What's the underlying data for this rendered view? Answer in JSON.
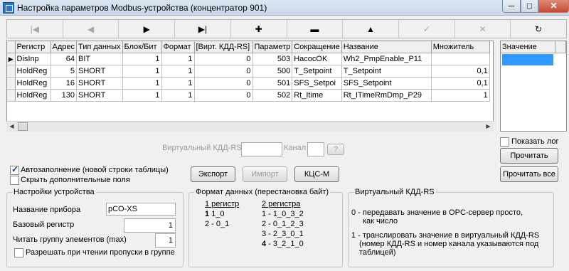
{
  "window": {
    "title": "Настройка параметров Modbus-устройства (концентратор 901)",
    "min": "─",
    "max": "□",
    "close": "✕"
  },
  "navigator": [
    {
      "glyph": "|◀",
      "enabled": false
    },
    {
      "glyph": "◀",
      "enabled": false
    },
    {
      "glyph": "▶",
      "enabled": true
    },
    {
      "glyph": "▶|",
      "enabled": true
    },
    {
      "glyph": "✚",
      "enabled": true
    },
    {
      "glyph": "▬",
      "enabled": true
    },
    {
      "glyph": "▲",
      "enabled": true
    },
    {
      "glyph": "✓",
      "enabled": false
    },
    {
      "glyph": "✕",
      "enabled": false
    },
    {
      "glyph": "↻",
      "enabled": true
    }
  ],
  "grid": {
    "columns": [
      "Регистр",
      "Адрес",
      "Тип данных",
      "Блок/Бит",
      "Формат",
      "[Вирт. КДД-RS]",
      "Параметр",
      "Сокращение",
      "Название",
      "Множитель"
    ],
    "rows": [
      [
        "DisInp",
        "64",
        "BIT",
        "1",
        "1",
        "0",
        "503",
        "HacocOK",
        "Wh2_PmpEnable_P11",
        ""
      ],
      [
        "HoldReg",
        "5",
        "SHORT",
        "1",
        "1",
        "0",
        "500",
        "T_Setpoint",
        "T_Setpoint",
        "0,1"
      ],
      [
        "HoldReg",
        "16",
        "SHORT",
        "1",
        "1",
        "0",
        "501",
        "SFS_Setpoi",
        "SFS_Setpoint",
        "0,1"
      ],
      [
        "HoldReg",
        "130",
        "SHORT",
        "1",
        "1",
        "0",
        "502",
        "Rt_Itime",
        "Rt_ITimeRmDmp_P29",
        "1"
      ]
    ],
    "current_row_marker": "▶"
  },
  "value_grid": {
    "column": "Значение"
  },
  "virtual": {
    "label": "Виртуальный КДД-RS",
    "channel_label": "Канал",
    "help": "?"
  },
  "show_log": {
    "label": "Показать лог",
    "checked": false
  },
  "buttons": {
    "read_one": "Прочитать один",
    "read_all": "Прочитать все",
    "export": "Экспорт",
    "import": "Импорт",
    "kcs": "КЦС-М"
  },
  "autofill": {
    "label": "Автозаполнение (новой строки таблицы)",
    "checked": true
  },
  "hide_fields": {
    "label": "Скрыть дополнительные поля",
    "checked": false
  },
  "device": {
    "title": "Настройки устройства",
    "name_label": "Название прибора",
    "name_value": "pCO-XS",
    "base_label": "Базовый регистр",
    "base_value": "1",
    "group_label": "Читать группу элементов (max)",
    "group_value": "1",
    "allow_gaps_label": "Разрешать при чтении пропуски в группе",
    "allow_gaps_checked": false
  },
  "format": {
    "title": "Формат данных (перестановка байт)",
    "col1_header": "1 регистр",
    "col1": [
      {
        "num": "1",
        "text": "1_0"
      },
      {
        "num": "",
        "text": "2 - 0_1"
      }
    ],
    "col2_header": "2 регистра",
    "col2": [
      "1 - 1_0_3_2",
      "2 - 0_1_2_3",
      "3 - 2_3_0_1"
    ],
    "col2_last": {
      "num": "4",
      "text": "- 3_2_1_0"
    }
  },
  "vkdd": {
    "title": "Виртуальный КДД-RS",
    "line0a": "0 - передавать значение в OPC-сервер просто,",
    "line0b": "как число",
    "line1a": "1 - транслировать значение в виртуальный КДД-RS",
    "line1b": "(номер КДД-RS и номер канала указываются под",
    "line1c": "таблицей)"
  },
  "colors": {
    "selection": "#3399ff",
    "close": "#c34a33"
  }
}
